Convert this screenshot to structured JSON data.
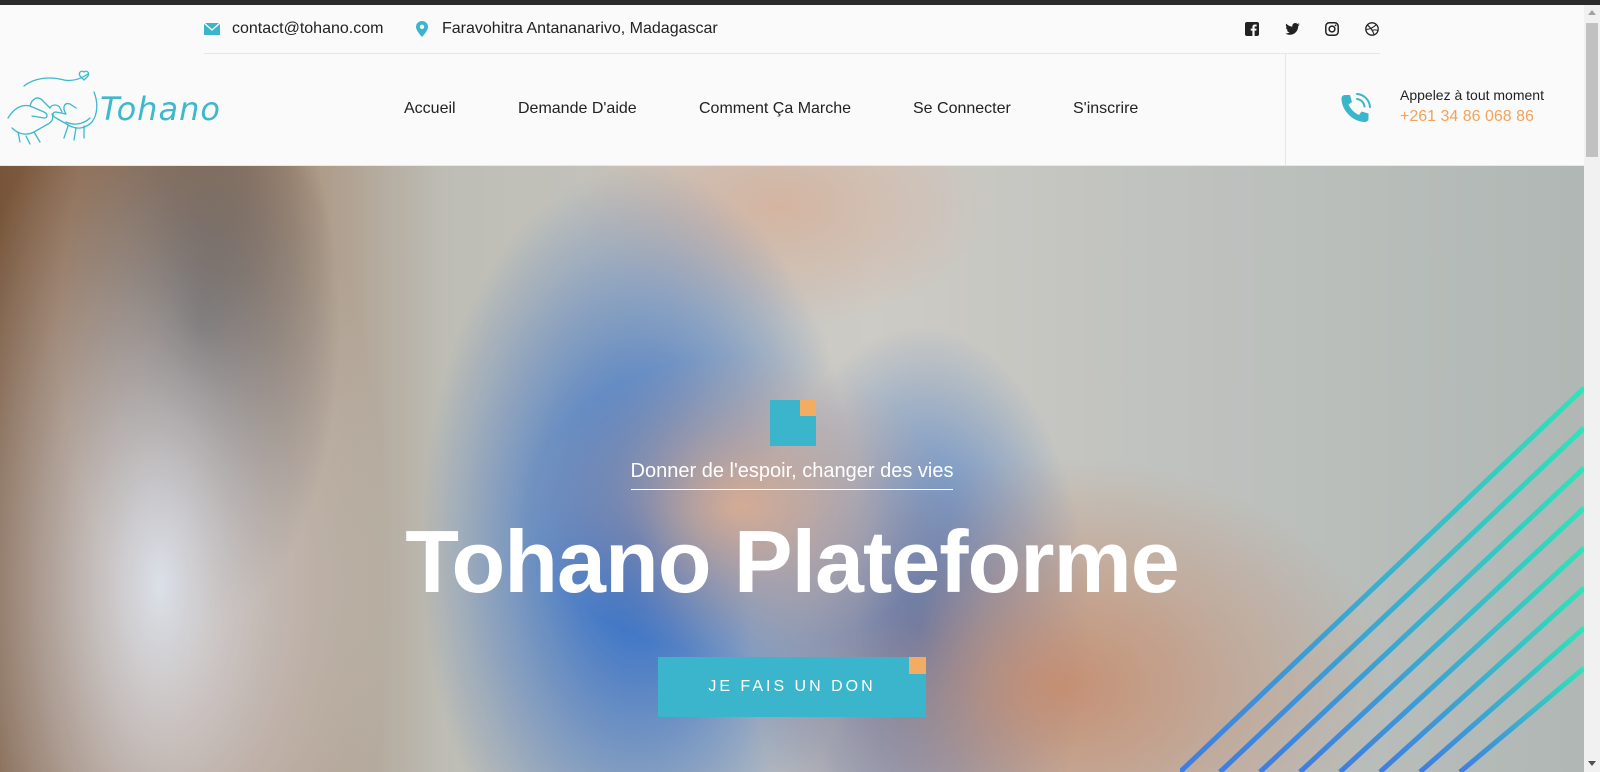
{
  "topbar": {
    "email": "contact@tohano.com",
    "address": "Faravohitra Antananarivo, Madagascar",
    "social_icons": [
      "facebook-icon",
      "twitter-icon",
      "instagram-icon",
      "dribbble-icon"
    ]
  },
  "header": {
    "logo_text": "Tohano",
    "nav": [
      {
        "label": "Accueil"
      },
      {
        "label": "Demande D'aide"
      },
      {
        "label": "Comment Ça Marche"
      },
      {
        "label": "Se Connecter"
      },
      {
        "label": "S'inscrire"
      }
    ],
    "call_label": "Appelez à tout moment",
    "call_number": "+261 34 86 068 86"
  },
  "hero": {
    "subtitle": "Donner de l'espoir, changer des vies",
    "title": "Tohano Plateforme",
    "button_label": "JE FAIS UN DON"
  },
  "colors": {
    "accent": "#3ab5cb",
    "orange": "#f2ad63",
    "phone_number": "#f0a35a"
  }
}
